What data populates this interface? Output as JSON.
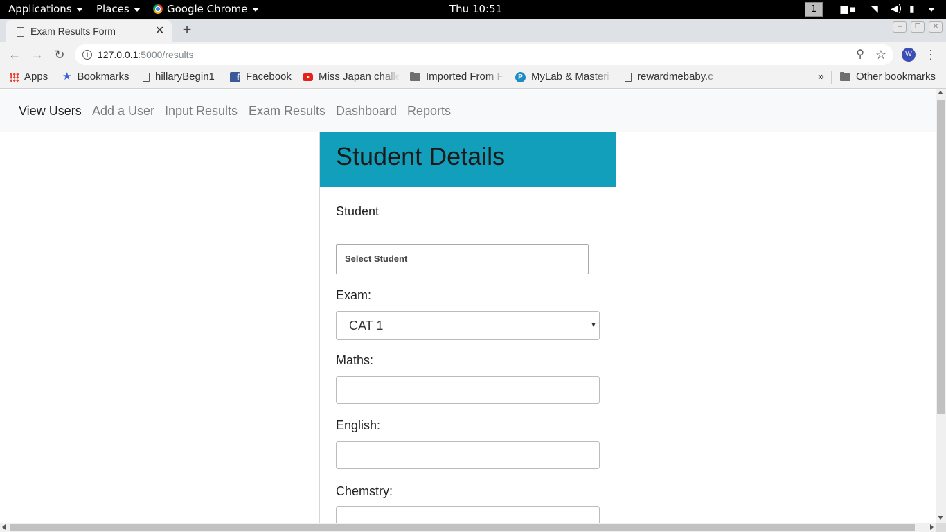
{
  "system_bar": {
    "applications": "Applications",
    "places": "Places",
    "active_app": "Google Chrome",
    "clock": "Thu 10:51",
    "workspace": "1"
  },
  "browser": {
    "tab_title": "Exam Results Form",
    "url_host": "127.0.0.1",
    "url_path": ":5000/results",
    "profile_initial": "W",
    "bookmarks": [
      {
        "label": "Apps",
        "icon": "apps-grid-icon"
      },
      {
        "label": "Bookmarks",
        "icon": "star-icon"
      },
      {
        "label": "hillaryBegin1",
        "icon": "page-icon"
      },
      {
        "label": "Facebook",
        "icon": "facebook-icon"
      },
      {
        "label": "Miss Japan challe",
        "icon": "youtube-icon"
      },
      {
        "label": "Imported From F",
        "icon": "folder-icon"
      },
      {
        "label": "MyLab & Masteri",
        "icon": "pearson-icon"
      },
      {
        "label": "rewardmebaby.c",
        "icon": "page-icon"
      }
    ],
    "overflow": "»",
    "other_bookmarks": "Other bookmarks"
  },
  "nav": {
    "links": [
      "View Users",
      "Add a User",
      "Input Results",
      "Exam Results",
      "Dashboard",
      "Reports"
    ],
    "active": "View Users"
  },
  "form": {
    "header": "Student Details",
    "student_label": "Student",
    "student_placeholder": "Select Student",
    "exam_label": "Exam:",
    "exam_value": "CAT 1",
    "maths_label": "Maths:",
    "maths_value": "",
    "english_label": "English:",
    "english_value": "",
    "chemistry_label": "Chemstry:",
    "chemistry_value": ""
  },
  "colors": {
    "card_header": "#129fbc",
    "navbar_bg": "#f8f9fa"
  }
}
